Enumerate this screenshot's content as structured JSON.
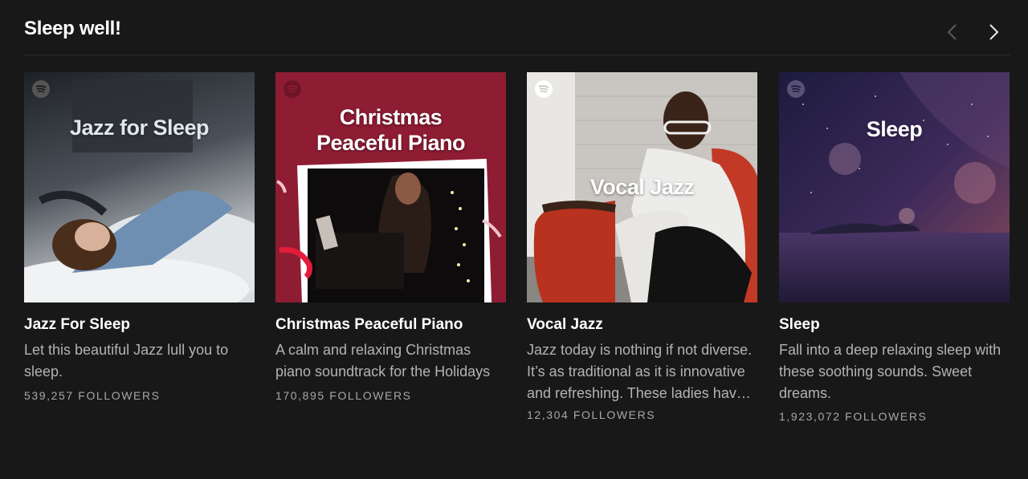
{
  "shelf": {
    "title": "Sleep well!",
    "prev_icon": "chevron-left-icon",
    "next_icon": "chevron-right-icon"
  },
  "playlists": [
    {
      "cover_text": "Jazz for Sleep",
      "title": "Jazz For Sleep",
      "description": "Let this beautiful Jazz lull you to sleep.",
      "followers": "539,257 FOLLOWERS",
      "accent": "#2a2f35"
    },
    {
      "cover_text_line1": "Christmas",
      "cover_text_line2": "Peaceful Piano",
      "title": "Christmas Peaceful Piano",
      "description": "A calm and relaxing Christmas piano soundtrack for the Holidays",
      "followers": "170,895 FOLLOWERS",
      "accent": "#8e1c33"
    },
    {
      "cover_text": "Vocal Jazz",
      "title": "Vocal Jazz",
      "description": "Jazz today is nothing if not diverse. It’s as traditional as it is innovative and refreshing. These ladies have some of the best voices around.",
      "followers": "12,304 FOLLOWERS",
      "accent": "#b8321f"
    },
    {
      "cover_text": "Sleep",
      "title": "Sleep",
      "description": "Fall into a deep relaxing sleep with these soothing sounds. Sweet dreams.",
      "followers": "1,923,072 FOLLOWERS",
      "accent": "#3a2a5a"
    }
  ],
  "colors": {
    "background": "#181818",
    "title_text": "#ffffff",
    "secondary_text": "#b3b3b3"
  }
}
